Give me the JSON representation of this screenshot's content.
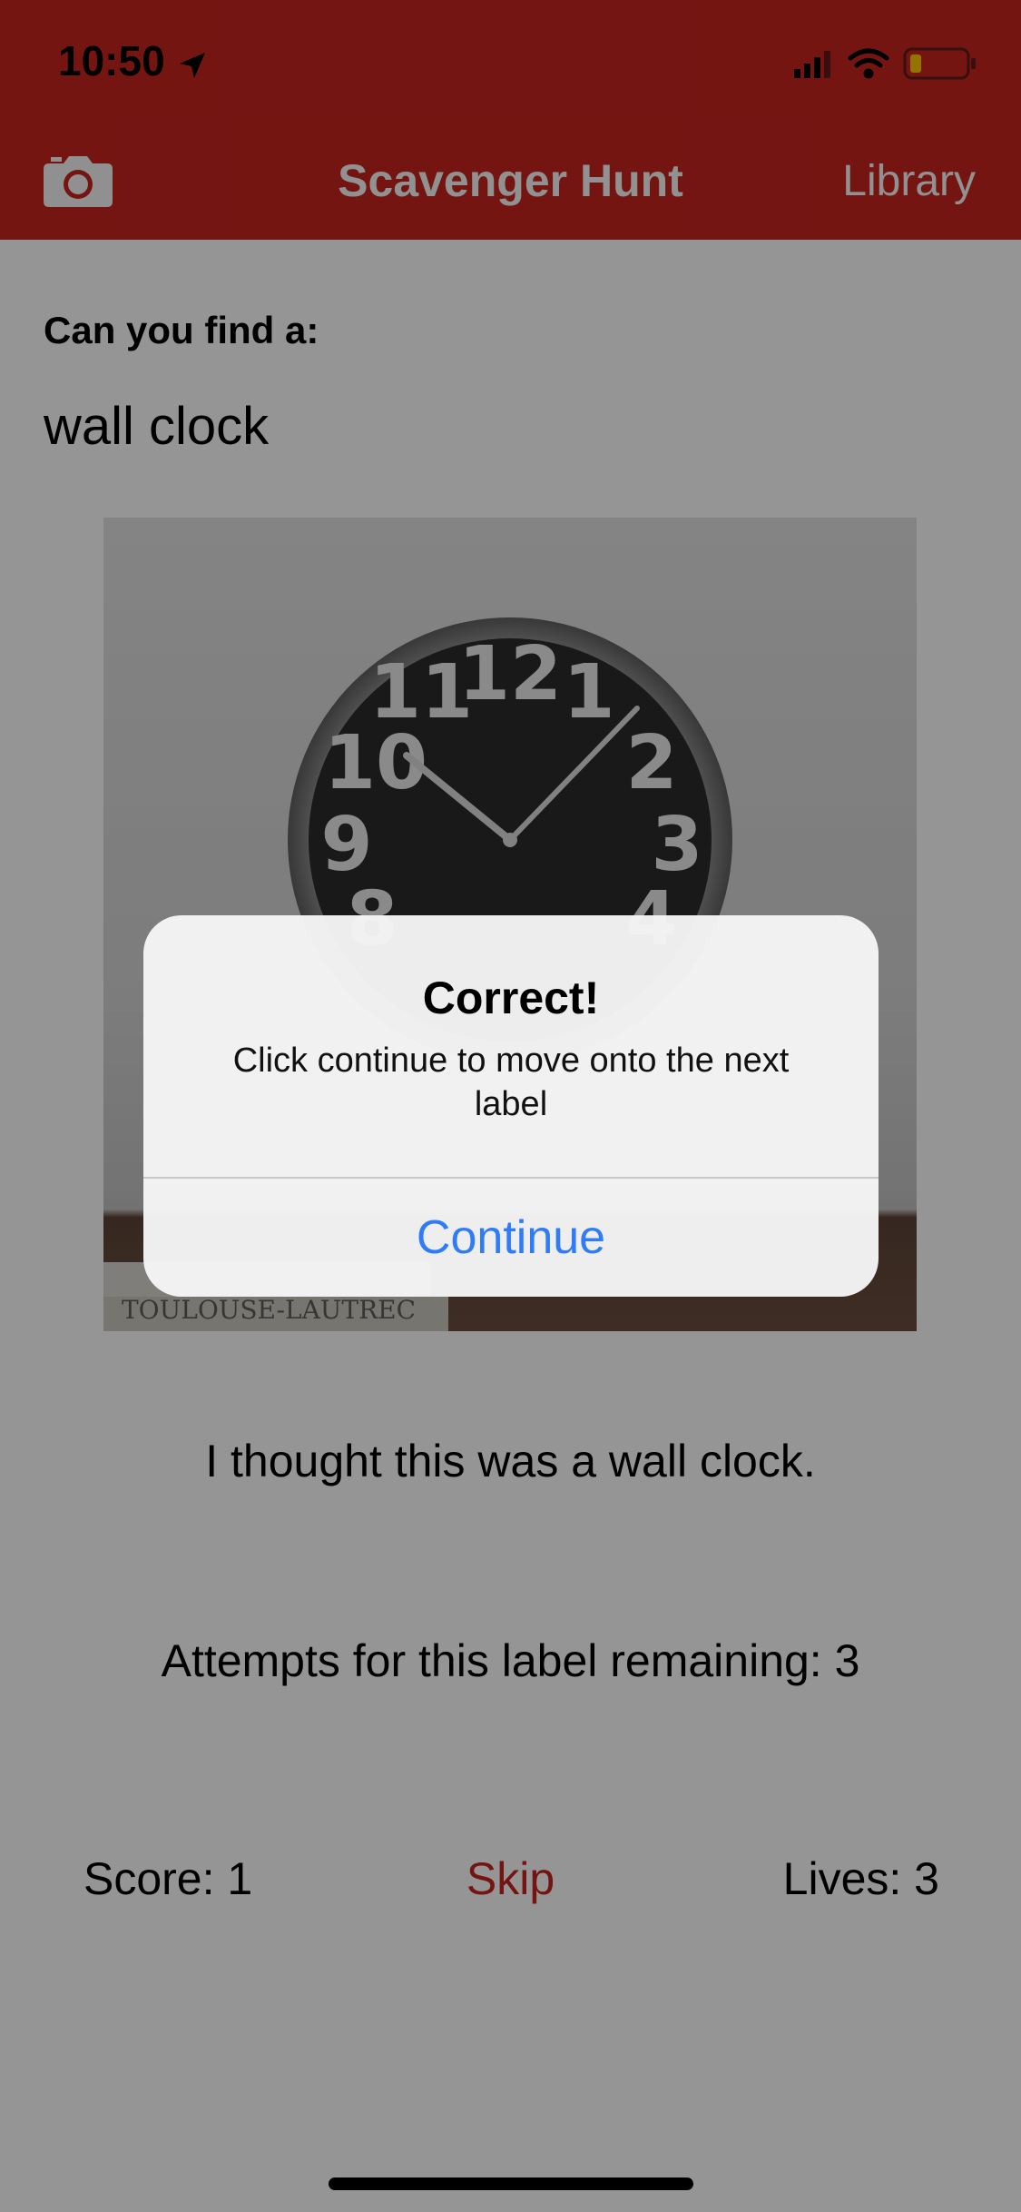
{
  "status_bar": {
    "time": "10:50",
    "icons": [
      "location-arrow-icon",
      "cellular-signal-icon",
      "wifi-icon",
      "battery-low-icon"
    ]
  },
  "nav": {
    "camera_icon": "camera-icon",
    "title": "Scavenger Hunt",
    "library_label": "Library"
  },
  "main": {
    "prompt": "Can you find a:",
    "target_label": "wall clock",
    "image_description_label": "wall clock photo",
    "clock_numbers": [
      "11",
      "12",
      "1",
      "10",
      "2",
      "9",
      "3",
      "4",
      "8"
    ],
    "book_text": "TOULOUSE-LAUTREC",
    "thought_text": "I thought this was a wall clock.",
    "attempts_text": "Attempts for this label remaining: 3"
  },
  "footer": {
    "score": "Score: 1",
    "skip": "Skip",
    "lives": "Lives: 3"
  },
  "alert": {
    "title": "Correct!",
    "message": "Click continue to move onto the next label",
    "button": "Continue"
  },
  "colors": {
    "brand_red": "#c3231f",
    "link_blue": "#2f7cf6"
  }
}
